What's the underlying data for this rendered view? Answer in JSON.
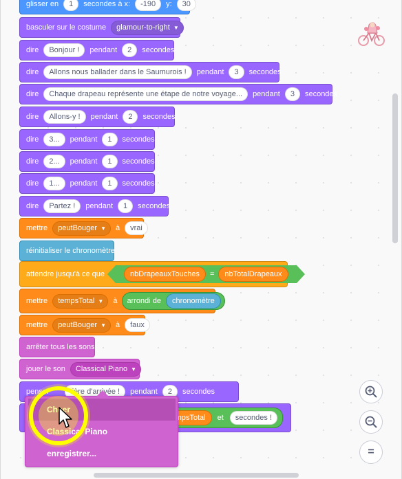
{
  "blocks": {
    "glide": {
      "p1": "glisser en",
      "v1": "1",
      "p2": "secondes à x:",
      "v2": "-190",
      "p3": "y:",
      "v3": "30"
    },
    "costume": {
      "p1": "basculer sur le costume",
      "dd": "glamour-to-right"
    },
    "say1": {
      "p1": "dire",
      "v1": "Bonjour !",
      "p2": "pendant",
      "v2": "2",
      "p3": "secondes"
    },
    "say2": {
      "p1": "dire",
      "v1": "Allons nous ballader dans le Saumurois !",
      "p2": "pendant",
      "v2": "3",
      "p3": "secondes"
    },
    "say3": {
      "p1": "dire",
      "v1": "Chaque drapeau représente une étape de notre voyage...",
      "p2": "pendant",
      "v2": "3",
      "p3": "secondes"
    },
    "say4": {
      "p1": "dire",
      "v1": "Allons-y !",
      "p2": "pendant",
      "v2": "2",
      "p3": "secondes"
    },
    "say5": {
      "p1": "dire",
      "v1": "3...",
      "p2": "pendant",
      "v2": "1",
      "p3": "secondes"
    },
    "say6": {
      "p1": "dire",
      "v1": "2...",
      "p2": "pendant",
      "v2": "1",
      "p3": "secondes"
    },
    "say7": {
      "p1": "dire",
      "v1": "1...",
      "p2": "pendant",
      "v2": "1",
      "p3": "secondes"
    },
    "say8": {
      "p1": "dire",
      "v1": "Partez !",
      "p2": "pendant",
      "v2": "1",
      "p3": "secondes"
    },
    "set1": {
      "p1": "mettre",
      "dd": "peutBouger",
      "p2": "à",
      "v1": "vrai"
    },
    "reset": {
      "p1": "réinitialiser le chronomètre"
    },
    "wait": {
      "p1": "attendre jusqu'à ce que",
      "a": "nbDrapeauxTouches",
      "op": "=",
      "b": "nbTotalDrapeaux"
    },
    "set2": {
      "p1": "mettre",
      "dd": "tempsTotal",
      "p2": "à",
      "round": "arrondi de",
      "r": "chronomètre"
    },
    "set3": {
      "p1": "mettre",
      "dd": "peutBouger",
      "p2": "à",
      "v1": "faux"
    },
    "stop": {
      "p1": "arrêter tous les sons"
    },
    "play": {
      "p1": "jouer le son",
      "dd": "Classical Piano"
    },
    "think": {
      "p1": "penser",
      "v1": "tière d'arrivée !",
      "p2": "pendant",
      "v2": "2",
      "p3": "secondes"
    },
    "last": {
      "t1": "tempsTotal",
      "t2": "et",
      "t3": "secondes !"
    }
  },
  "menu": {
    "items": [
      "Cheer",
      "Classical Piano",
      "enregistrer..."
    ]
  },
  "zoom": {
    "in_icon": "zoom-in-icon",
    "out_icon": "zoom-out-icon",
    "reset_icon": "zoom-reset-icon",
    "reset_glyph": "="
  },
  "colors": {
    "looks": "#9966ff",
    "motion": "#4c97ff",
    "variables": "#ff8c1a",
    "sensing": "#5cb1d6",
    "control": "#ffab19",
    "sound": "#cf63cf",
    "operators": "#59c059"
  }
}
